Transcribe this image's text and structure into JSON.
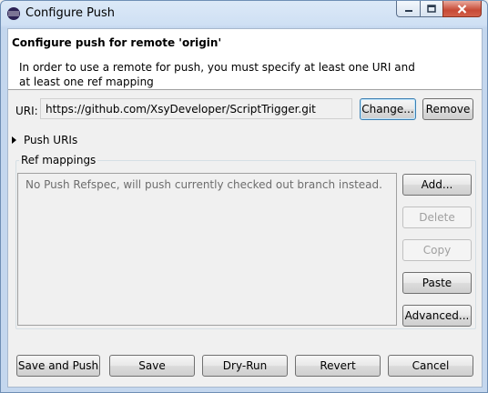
{
  "window": {
    "title": "Configure Push",
    "controls": [
      "minimize",
      "maximize",
      "close"
    ]
  },
  "header": {
    "title": "Configure push for remote 'origin'",
    "message_line1": "In order to use a remote for push, you must specify at least one URI and",
    "message_line2": "at least one ref mapping"
  },
  "uri": {
    "label": "URI:",
    "value": "https://github.com/XsyDeveloper/ScriptTrigger.git",
    "change_button": "Change...",
    "remove_button": "Remove"
  },
  "push_uris": {
    "label": "Push URIs",
    "expanded": false
  },
  "ref_mappings": {
    "label": "Ref mappings",
    "empty_message": "No Push Refspec, will push currently checked out branch instead.",
    "buttons": {
      "add": "Add...",
      "delete": "Delete",
      "copy": "Copy",
      "paste": "Paste",
      "advanced": "Advanced..."
    }
  },
  "footer": {
    "save_and_push": "Save and Push",
    "save": "Save",
    "dry_run": "Dry-Run",
    "revert": "Revert",
    "cancel": "Cancel"
  },
  "colors": {
    "focus_border": "#3c7fb1",
    "disabled_text": "#a0a0a0"
  }
}
